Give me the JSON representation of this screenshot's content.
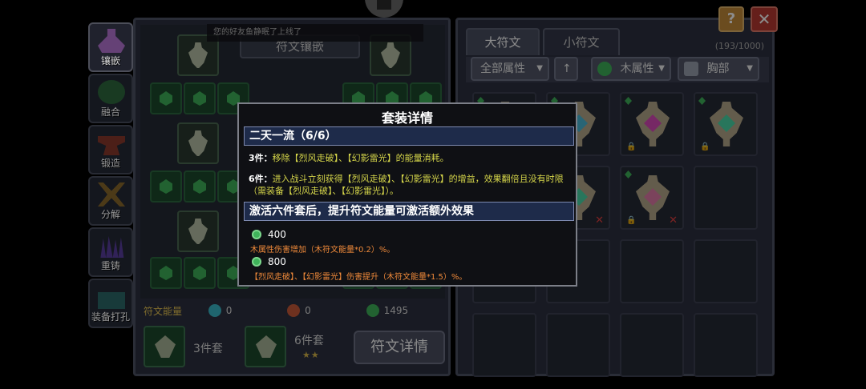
{
  "side_tabs": [
    {
      "label": "镶嵌",
      "active": true,
      "icon": "potion-icon",
      "color": "#b877d8"
    },
    {
      "label": "融合",
      "active": false,
      "icon": "gear-icon",
      "color": "#3aa05a"
    },
    {
      "label": "锻造",
      "active": false,
      "icon": "anvil-icon",
      "color": "#c8503a"
    },
    {
      "label": "分解",
      "active": false,
      "icon": "crossed-swords-icon",
      "color": "#c89a3a"
    },
    {
      "label": "重铸",
      "active": false,
      "icon": "crystals-icon",
      "color": "#7a5ad8"
    },
    {
      "label": "装备打孔",
      "active": false,
      "icon": "chest-icon",
      "color": "#3aa0a0"
    }
  ],
  "left_panel": {
    "slot_title": "符文镶嵌",
    "energy_label": "符文能量",
    "energy": [
      {
        "value": "0",
        "color": "#3ab8c8"
      },
      {
        "value": "0",
        "color": "#c85a3a"
      },
      {
        "value": "1495",
        "color": "#3fb35a"
      }
    ],
    "sets": [
      {
        "label": "3件套",
        "stars": ""
      },
      {
        "label": "6件套",
        "stars": "★★"
      }
    ],
    "detail_button": "符文详情"
  },
  "toast": "您的好友鱼静眠了上线了",
  "right_panel": {
    "tabs": [
      "大符文",
      "小符文"
    ],
    "counter": "(193/1000)",
    "filters": [
      {
        "label": "全部属性",
        "icon": ""
      },
      {
        "label": "↑",
        "icon": "arrow-up-icon"
      },
      {
        "label": "木属性",
        "icon": "wood-element-icon"
      },
      {
        "label": "胸部",
        "icon": "chest-armor-icon"
      }
    ],
    "grid_runes": [
      {
        "gem": "#8a4ad8",
        "lock": false,
        "x": false
      },
      {
        "gem": "#4ab8d8",
        "lock": true,
        "x": false
      },
      {
        "gem": "#d84ab8",
        "lock": true,
        "x": false
      },
      {
        "gem": "#4ad8a8",
        "lock": true,
        "x": false
      },
      {
        "gem": "#4ad8a8",
        "lock": false,
        "x": true
      },
      {
        "gem": "#e07aa8",
        "lock": true,
        "x": true
      }
    ]
  },
  "buttons": {
    "help": "?",
    "close": "✕"
  },
  "modal": {
    "title": "套装详情",
    "set_name": "二天一流（6/6）",
    "effects": [
      {
        "tier": "3件：",
        "text": "移除【烈风走破】、【幻影雷光】的能量消耗。"
      },
      {
        "tier": "6件：",
        "text": "进入战斗立刻获得【烈风走破】、【幻影雷光】的增益，效果翻倍且没有时限（需装备【烈风走破】、【幻影雷光】）。"
      }
    ],
    "bonus_header": "激活六件套后，提升符文能量可激活额外效果",
    "bonuses": [
      {
        "value": "400",
        "desc": "木属性伤害增加（木符文能量*0.2）%。"
      },
      {
        "value": "800",
        "desc": "【烈风走破】、【幻影雷光】伤害提升（木符文能量*1.5）%。"
      }
    ],
    "colors": {
      "effect_text": "#d6d64a",
      "bonus_text": "#f08a3a",
      "header_bg": "#1e2b4a"
    }
  }
}
